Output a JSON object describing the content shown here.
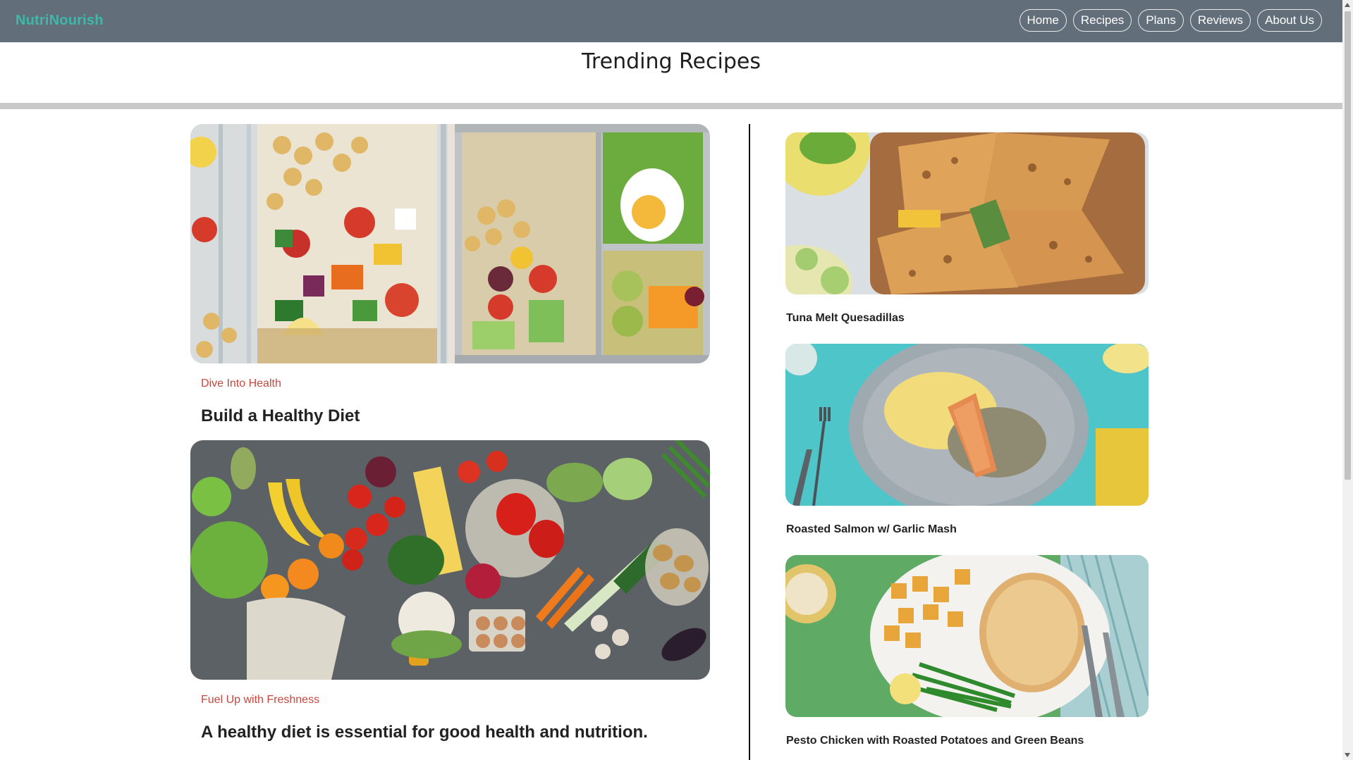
{
  "nav": {
    "brand": "NutriNourish",
    "links": [
      "Home",
      "Recipes",
      "Plans",
      "Reviews",
      "About Us"
    ]
  },
  "page": {
    "title": "Trending Recipes"
  },
  "features": [
    {
      "kicker": "Dive Into Health",
      "headline": "Build a Healthy Diet"
    },
    {
      "kicker": "Fuel Up with Freshness",
      "headline": "A healthy diet is essential for good health and nutrition."
    }
  ],
  "recipes": [
    {
      "title": "Tuna Melt Quesadillas"
    },
    {
      "title": "Roasted Salmon w/ Garlic Mash"
    },
    {
      "title": "Pesto Chicken with Roasted Potatoes and Green Beans"
    }
  ],
  "colors": {
    "nav_bg": "#636e7b",
    "brand": "#3fb8a9",
    "kicker": "#c5473e"
  }
}
